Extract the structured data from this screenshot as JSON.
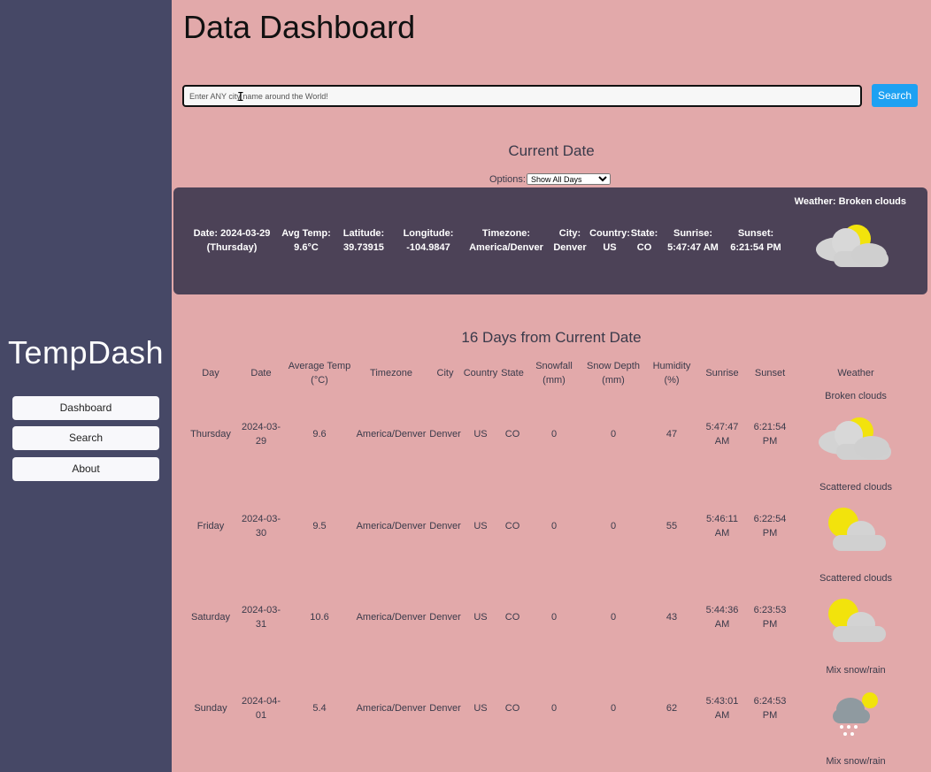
{
  "sidebar": {
    "brand": "TempDash",
    "nav": [
      {
        "label": "Dashboard"
      },
      {
        "label": "Search"
      },
      {
        "label": "About"
      }
    ]
  },
  "header": {
    "title": "Data Dashboard"
  },
  "search": {
    "placeholder": "Enter ANY city name around the World!",
    "button_label": "Search"
  },
  "current": {
    "section_title": "Current Date",
    "options_label": "Options:",
    "options_selected": "Show All Days",
    "weather_label": "Weather: Broken clouds",
    "fields": [
      {
        "label": "Date: 2024-03-29",
        "value": "(Thursday)"
      },
      {
        "label": "Avg Temp:",
        "value": "9.6°C"
      },
      {
        "label": "Latitude:",
        "value": "39.73915"
      },
      {
        "label": "Longitude:",
        "value": "-104.9847"
      },
      {
        "label": "Timezone:",
        "value": "America/Denver"
      },
      {
        "label": "City:",
        "value": "Denver"
      },
      {
        "label": "Country:",
        "value": "US"
      },
      {
        "label": "State:",
        "value": "CO"
      },
      {
        "label": "Sunrise:",
        "value": "5:47:47 AM"
      },
      {
        "label": "Sunset:",
        "value": "6:21:54 PM"
      }
    ],
    "icon": "broken-clouds-icon"
  },
  "forecast": {
    "section_title": "16 Days from Current Date",
    "columns": [
      {
        "l1": "Day",
        "l2": ""
      },
      {
        "l1": "Date",
        "l2": ""
      },
      {
        "l1": "Average Temp",
        "l2": "(°C)"
      },
      {
        "l1": "Timezone",
        "l2": ""
      },
      {
        "l1": "City",
        "l2": ""
      },
      {
        "l1": "Country",
        "l2": ""
      },
      {
        "l1": "State",
        "l2": ""
      },
      {
        "l1": "Snowfall",
        "l2": "(mm)"
      },
      {
        "l1": "Snow Depth",
        "l2": "(mm)"
      },
      {
        "l1": "Humidity",
        "l2": "(%)"
      },
      {
        "l1": "Sunrise",
        "l2": ""
      },
      {
        "l1": "Sunset",
        "l2": ""
      },
      {
        "l1": "Weather",
        "l2": ""
      }
    ],
    "rows": [
      {
        "day": "Thursday",
        "date1": "2024-03-",
        "date2": "29",
        "avg": "9.6",
        "tz": "America/Denver",
        "city": "Denver",
        "country": "US",
        "state": "CO",
        "snow": "0",
        "depth": "0",
        "hum": "47",
        "rise1": "5:47:47",
        "rise2": "AM",
        "set1": "6:21:54",
        "set2": "PM",
        "weather": "Broken clouds",
        "icon": "broken-clouds-icon"
      },
      {
        "day": "Friday",
        "date1": "2024-03-",
        "date2": "30",
        "avg": "9.5",
        "tz": "America/Denver",
        "city": "Denver",
        "country": "US",
        "state": "CO",
        "snow": "0",
        "depth": "0",
        "hum": "55",
        "rise1": "5:46:11",
        "rise2": "AM",
        "set1": "6:22:54",
        "set2": "PM",
        "weather": "Scattered clouds",
        "icon": "scattered-clouds-icon"
      },
      {
        "day": "Saturday",
        "date1": "2024-03-",
        "date2": "31",
        "avg": "10.6",
        "tz": "America/Denver",
        "city": "Denver",
        "country": "US",
        "state": "CO",
        "snow": "0",
        "depth": "0",
        "hum": "43",
        "rise1": "5:44:36",
        "rise2": "AM",
        "set1": "6:23:53",
        "set2": "PM",
        "weather": "Scattered clouds",
        "icon": "scattered-clouds-icon"
      },
      {
        "day": "Sunday",
        "date1": "2024-04-",
        "date2": "01",
        "avg": "5.4",
        "tz": "America/Denver",
        "city": "Denver",
        "country": "US",
        "state": "CO",
        "snow": "0",
        "depth": "0",
        "hum": "62",
        "rise1": "5:43:01",
        "rise2": "AM",
        "set1": "6:24:53",
        "set2": "PM",
        "weather": "Mix snow/rain",
        "icon": "snow-rain-icon"
      }
    ],
    "next_weather": "Mix snow/rain"
  }
}
